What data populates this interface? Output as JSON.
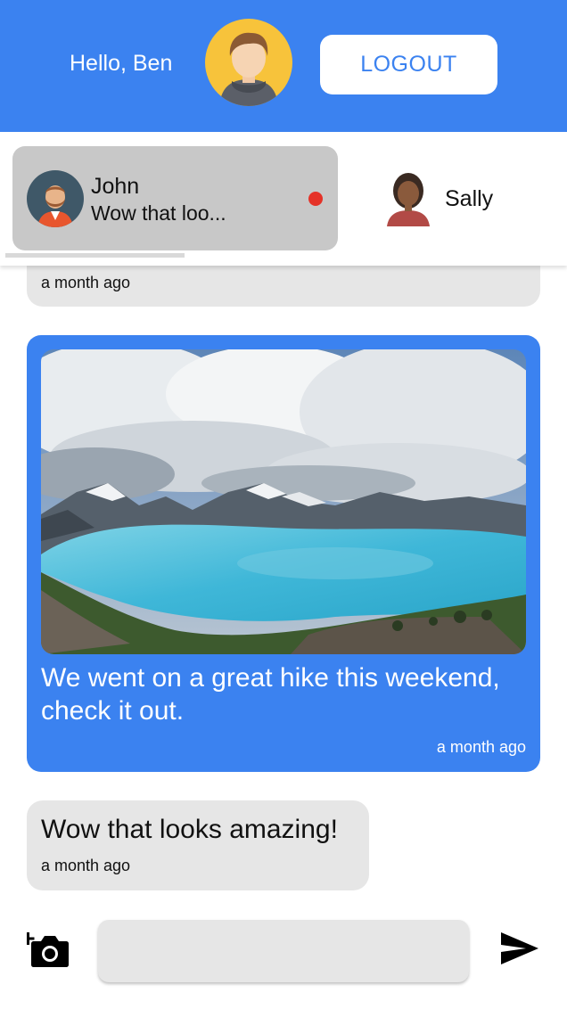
{
  "header": {
    "greeting": "Hello, Ben",
    "logout_label": "LOGOUT",
    "accent_color": "#3b82f0"
  },
  "conversations": [
    {
      "name": "John",
      "preview": "Wow that loo...",
      "unread": true,
      "active": true
    },
    {
      "name": "Sally",
      "active": false
    }
  ],
  "messages": [
    {
      "from": "other",
      "text": "",
      "time": "a month ago"
    },
    {
      "from": "me",
      "has_image": true,
      "text": "We went on a great hike this weekend, check it out.",
      "time": "a month ago"
    },
    {
      "from": "other",
      "text": "Wow that looks amazing!",
      "time": "a month ago"
    }
  ],
  "composer": {
    "input_value": "",
    "camera_icon": "add-photo-icon",
    "send_icon": "send-icon"
  }
}
